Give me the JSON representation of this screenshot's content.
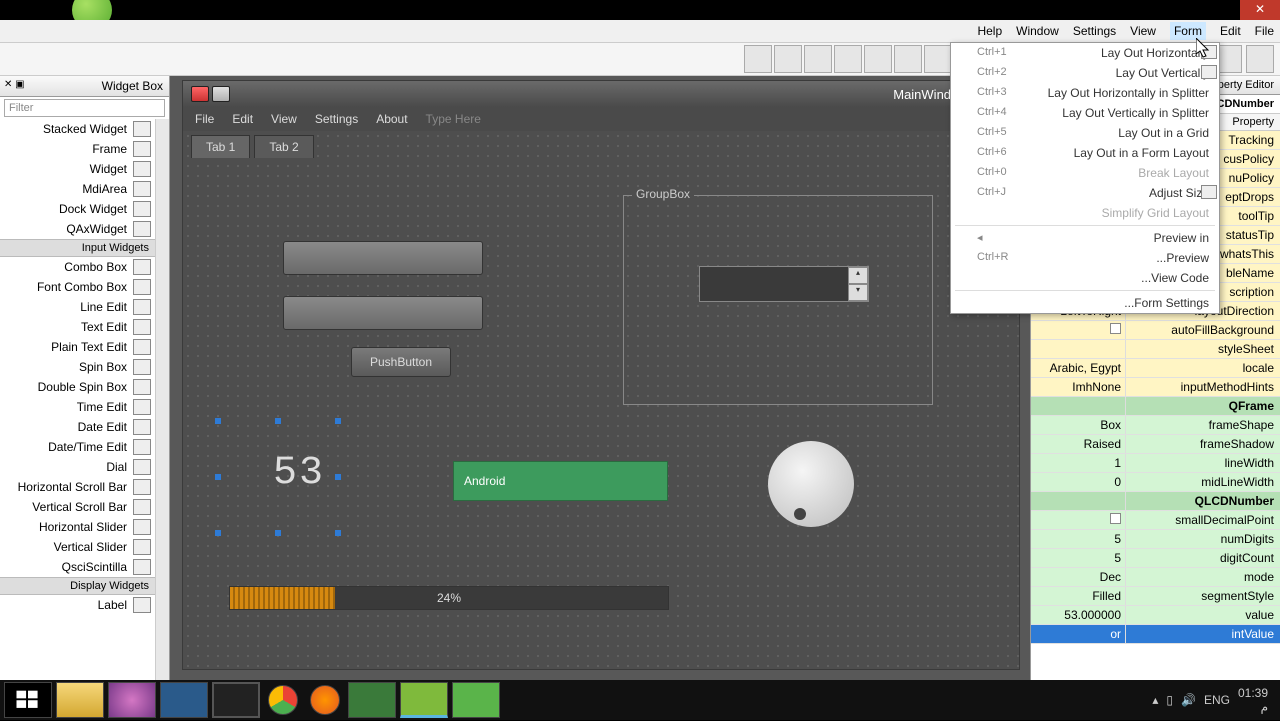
{
  "window": {
    "close_tip": "✕"
  },
  "menubar": {
    "help": "Help",
    "wnd": "Window",
    "settings": "Settings",
    "view": "View",
    "form": "Form",
    "edit": "Edit",
    "file": "File"
  },
  "widgetbox": {
    "title": "Widget Box",
    "filter_ph": "Filter",
    "items_top": [
      {
        "label": "Stacked Widget"
      },
      {
        "label": "Frame"
      },
      {
        "label": "Widget"
      },
      {
        "label": "MdiArea"
      },
      {
        "label": "Dock Widget"
      },
      {
        "label": "QAxWidget"
      }
    ],
    "cat_input": "Input Widgets",
    "items_input": [
      {
        "label": "Combo Box"
      },
      {
        "label": "Font Combo Box"
      },
      {
        "label": "Line Edit"
      },
      {
        "label": "Text Edit"
      },
      {
        "label": "Plain Text Edit"
      },
      {
        "label": "Spin Box"
      },
      {
        "label": "Double Spin Box"
      },
      {
        "label": "Time Edit"
      },
      {
        "label": "Date Edit"
      },
      {
        "label": "Date/Time Edit"
      },
      {
        "label": "Dial"
      },
      {
        "label": "Horizontal Scroll Bar"
      },
      {
        "label": "Vertical Scroll Bar"
      },
      {
        "label": "Horizontal Slider"
      },
      {
        "label": "Vertical Slider"
      },
      {
        "label": "QsciScintilla"
      }
    ],
    "cat_display": "Display Widgets",
    "items_display": [
      {
        "label": "Label"
      }
    ]
  },
  "designer_window": {
    "title": "MainWindow - main.",
    "menus": [
      "File",
      "Edit",
      "View",
      "Settings",
      "About",
      "Type Here"
    ],
    "tabs": [
      "Tab 1",
      "Tab 2"
    ],
    "pushbtn": "PushButton",
    "groupbox": "GroupBox",
    "lcd": "53",
    "android": "Android",
    "progress": "24%",
    "progress_pct": 24
  },
  "form_menu": {
    "items": [
      {
        "sc": "Ctrl+1",
        "label": "Lay Out Horizontally",
        "icon": true
      },
      {
        "sc": "Ctrl+2",
        "label": "Lay Out Vertically",
        "icon": true
      },
      {
        "sc": "Ctrl+3",
        "label": "Lay Out Horizontally in Splitter"
      },
      {
        "sc": "Ctrl+4",
        "label": "Lay Out Vertically in Splitter"
      },
      {
        "sc": "Ctrl+5",
        "label": "Lay Out in a Grid"
      },
      {
        "sc": "Ctrl+6",
        "label": "Lay Out in a Form Layout"
      },
      {
        "sc": "Ctrl+0",
        "label": "Break Layout",
        "dis": true
      },
      {
        "sc": "Ctrl+J",
        "label": "Adjust Size",
        "icon": true
      },
      {
        "sc": "",
        "label": "Simplify Grid Layout",
        "dis": true
      }
    ],
    "items2": [
      {
        "sc": "◂",
        "label": "Preview in"
      },
      {
        "sc": "Ctrl+R",
        "label": "...Preview"
      },
      {
        "sc": "",
        "label": "...View Code"
      }
    ],
    "items3": [
      {
        "sc": "",
        "label": "...Form Settings"
      }
    ]
  },
  "prop": {
    "title": "roperty Editor",
    "obj": "QLCDNumber",
    "colhead": "Property",
    "rows1": [
      {
        "name": "Tracking",
        "val": ""
      },
      {
        "name": "cusPolicy",
        "val": ""
      },
      {
        "name": "nuPolicy",
        "val": ""
      },
      {
        "name": "eptDrops",
        "val": ""
      },
      {
        "name": "toolTip",
        "val": ""
      },
      {
        "name": "statusTip",
        "val": ""
      },
      {
        "name": "whatsThis",
        "val": ""
      },
      {
        "name": "bleName",
        "val": ""
      },
      {
        "name": "scription",
        "val": ""
      },
      {
        "name": "layoutDirection",
        "val": "LeftToRight"
      },
      {
        "name": "autoFillBackground",
        "val": "chk"
      },
      {
        "name": "styleSheet",
        "val": ""
      },
      {
        "name": "locale",
        "val": "Arabic, Egypt"
      },
      {
        "name": "inputMethodHints",
        "val": "ImhNone"
      }
    ],
    "hdr_frame": "QFrame",
    "rows_frame": [
      {
        "name": "frameShape",
        "val": "Box"
      },
      {
        "name": "frameShadow",
        "val": "Raised"
      },
      {
        "name": "lineWidth",
        "val": "1"
      },
      {
        "name": "midLineWidth",
        "val": "0"
      }
    ],
    "hdr_lcd": "QLCDNumber",
    "rows_lcd": [
      {
        "name": "smallDecimalPoint",
        "val": "chk"
      },
      {
        "name": "numDigits",
        "val": "5"
      },
      {
        "name": "digitCount",
        "val": "5"
      },
      {
        "name": "mode",
        "val": "Dec"
      },
      {
        "name": "segmentStyle",
        "val": "Filled"
      },
      {
        "name": "value",
        "val": "53.000000"
      }
    ],
    "sel": {
      "name": "intValue",
      "val": "or"
    }
  },
  "taskbar": {
    "lang": "ENG",
    "time": "01:39",
    "date": "م"
  }
}
